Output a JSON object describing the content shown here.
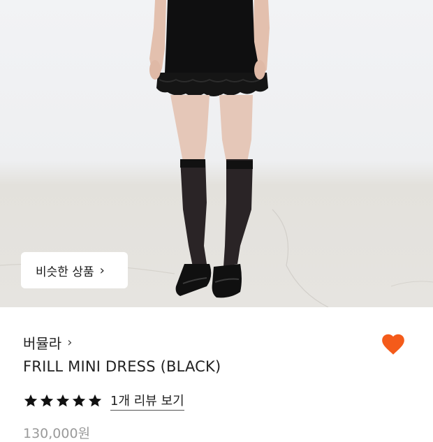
{
  "product_image": {
    "alt": ""
  },
  "similar_button": {
    "label": "비슷한 상품",
    "icon": "chevron-right-icon"
  },
  "brand": {
    "name": "버뮬라",
    "icon": "chevron-right-icon"
  },
  "favorite": {
    "icon": "heart-icon",
    "color": "#f45b1a",
    "active": true
  },
  "product": {
    "title": "FRILL MINI DRESS (BLACK)",
    "price": "130,000원"
  },
  "rating": {
    "stars": 5,
    "max": 5,
    "review_link": "1개 리뷰 보기"
  }
}
